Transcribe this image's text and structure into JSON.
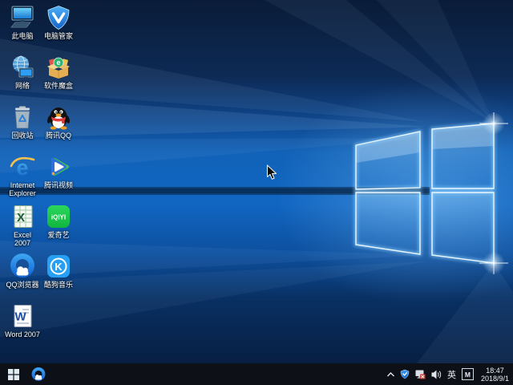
{
  "wallpaper": {
    "name": "windows-10-hero",
    "base_blue": "#1166c2",
    "dark_navy": "#0a1c38"
  },
  "desktop": {
    "icons": [
      {
        "label": "此电脑",
        "icon": "computer-monitor-icon"
      },
      {
        "label": "电脑管家",
        "icon": "blue-shield-icon"
      },
      {
        "label": "网络",
        "icon": "globe-monitor-icon"
      },
      {
        "label": "软件魔盒",
        "icon": "open-box-icon"
      },
      {
        "label": "回收站",
        "icon": "recycle-bin-icon"
      },
      {
        "label": "腾讯QQ",
        "icon": "penguin-icon"
      },
      {
        "label": "Internet Explorer",
        "icon": "ie-e-icon"
      },
      {
        "label": "腾讯视频",
        "icon": "play-triangle-icon"
      },
      {
        "label": "Excel 2007",
        "icon": "excel-spreadsheet-icon"
      },
      {
        "label": "爱奇艺",
        "icon": "iqiyi-logo-icon"
      },
      {
        "label": "QQ浏览器",
        "icon": "blue-ring-cloud-icon"
      },
      {
        "label": "酷狗音乐",
        "icon": "k-circle-icon"
      },
      {
        "label": "Word 2007",
        "icon": "word-document-icon"
      }
    ],
    "iqiyi_text": "iQIYI",
    "kugou_letter": "K",
    "word_letter": "W",
    "excel_letter": "X",
    "ie_letter": "e",
    "box_letter": "e"
  },
  "taskbar": {
    "icons": [
      "start-icon",
      "qq-browser-icon"
    ],
    "tray": {
      "icons": [
        "chevron-up-icon",
        "shield-icon",
        "network-error-icon",
        "speaker-icon"
      ],
      "ime_language": "英",
      "ime_mode": "M",
      "time": "18:47",
      "date": "2018/9/1"
    }
  },
  "colors": {
    "taskbar_bg": "#0d1117",
    "accent_blue": "#1e90e8",
    "tray_icon": "#dfe6ec"
  }
}
